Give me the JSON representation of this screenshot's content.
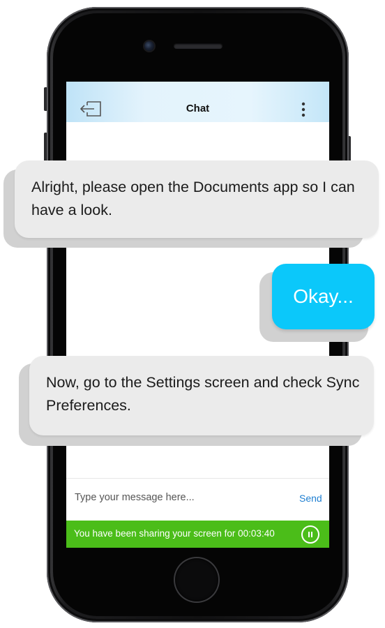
{
  "header": {
    "title": "Chat"
  },
  "messages": [
    {
      "sender": "agent",
      "text": "Alright, please open the Documents app so I can have a look."
    },
    {
      "sender": "user",
      "text": "Okay..."
    },
    {
      "sender": "agent",
      "text": "Now, go to the Settings screen and check Sync Preferences."
    }
  ],
  "composer": {
    "placeholder": "Type your message here...",
    "send_label": "Send"
  },
  "screen_share": {
    "text": "You have been sharing your screen for 00:03:40",
    "color": "#4bbd19"
  },
  "icons": {
    "exit": "exit-icon",
    "menu": "more-vertical-icon",
    "pause": "pause-icon"
  },
  "colors": {
    "user_bubble": "#0bc8fa",
    "agent_bubble": "#ebebeb",
    "link": "#1f7fd1"
  }
}
